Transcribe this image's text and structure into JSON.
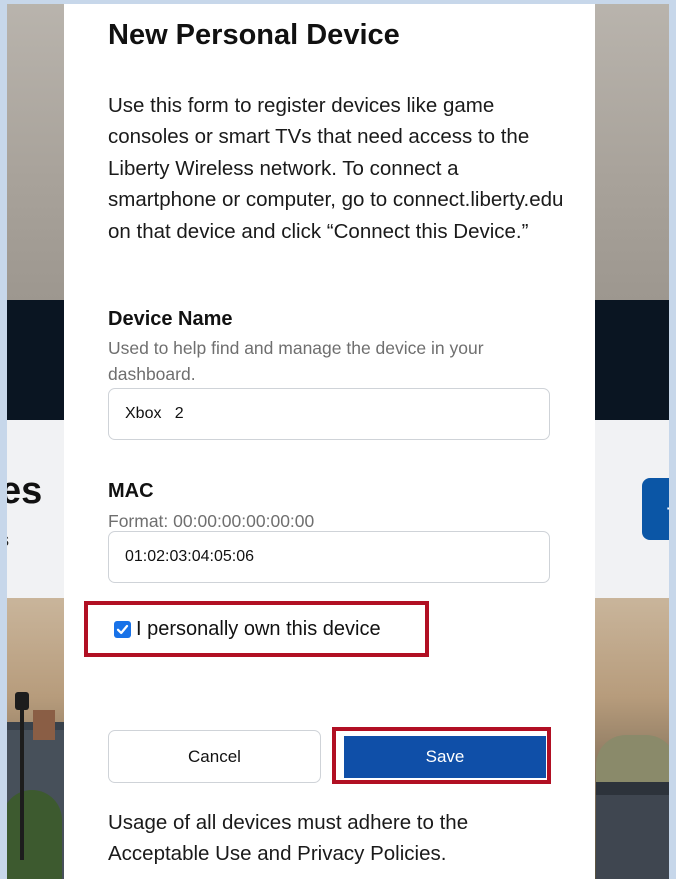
{
  "background": {
    "heading_fragment": "es",
    "sub_fragment": "s",
    "add_button_glyph": "+"
  },
  "modal": {
    "title": "New Personal Device",
    "description": "Use this form to register devices like game consoles or smart TVs that need access to the Liberty Wireless network. To connect a smartphone or computer, go to connect.liberty.edu on that device and click “Connect this Device.”",
    "device_name": {
      "label": "Device Name",
      "help": "Used to help find and manage the device in your dashboard.",
      "value": "Xbox   2"
    },
    "mac": {
      "label": "MAC",
      "help": "Format: 00:00:00:00:00:00",
      "value": "01:02:03:04:05:06"
    },
    "ownership": {
      "label": "I personally own this device",
      "checked": true
    },
    "buttons": {
      "cancel": "Cancel",
      "save": "Save"
    },
    "footer": "Usage of all devices must adhere to the Acceptable Use and Privacy Policies."
  },
  "colors": {
    "primary": "#0f4fa8",
    "highlight": "#b10f23",
    "checkbox": "#1872e8"
  }
}
